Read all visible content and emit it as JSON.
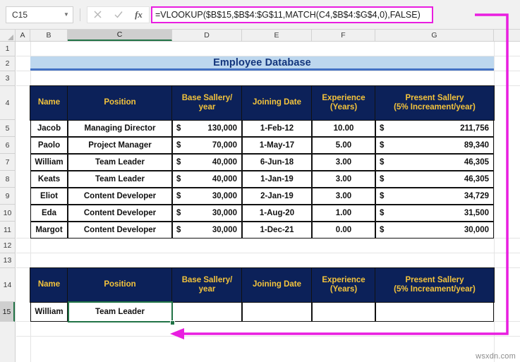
{
  "formula_bar": {
    "name_box_value": "C15",
    "name_box_dropdown_icon": "chevron-down-icon",
    "cancel_icon": "close-icon",
    "confirm_icon": "check-icon",
    "function_icon": "fx-icon",
    "formula": "=VLOOKUP($B$15,$B$4:$G$11,MATCH(C4,$B$4:$G$4,0),FALSE)",
    "highlight_color": "#e91ee0"
  },
  "grid": {
    "column_headers": [
      "A",
      "B",
      "C",
      "D",
      "E",
      "F",
      "G"
    ],
    "selected_column": "C",
    "row_headers": [
      "1",
      "2",
      "3",
      "4",
      "5",
      "6",
      "7",
      "8",
      "9",
      "10",
      "11",
      "12",
      "13",
      "14",
      "15"
    ],
    "selected_row": "15"
  },
  "sheet": {
    "title": "Employee Database",
    "title_bg": "#bdd7ee",
    "title_text_color": "#13357c",
    "header_bg": "#0c2159",
    "header_text_color": "#f3c33c",
    "selection_color": "#217346",
    "columns": [
      "Name",
      "Position",
      "Base Sallery/ year",
      "Joining Date",
      "Experience (Years)",
      "Present Sallery (5% Increament/year)"
    ],
    "column_lines": {
      "base_sallery_line1": "Base Sallery/",
      "base_sallery_line2": "year",
      "joining_date_line1": "Joining Date",
      "experience_line1": "Experience",
      "experience_line2": "(Years)",
      "present_sallery_line1": "Present Sallery",
      "present_sallery_line2": "(5% Increament/year)"
    },
    "rows": [
      {
        "name": "Jacob",
        "position": "Managing Director",
        "base_currency": "$",
        "base_amount": "130,000",
        "joining_date": "1-Feb-12",
        "experience": "10.00",
        "present_currency": "$",
        "present_amount": "211,756"
      },
      {
        "name": "Paolo",
        "position": "Project Manager",
        "base_currency": "$",
        "base_amount": "70,000",
        "joining_date": "1-May-17",
        "experience": "5.00",
        "present_currency": "$",
        "present_amount": "89,340"
      },
      {
        "name": "William",
        "position": "Team Leader",
        "base_currency": "$",
        "base_amount": "40,000",
        "joining_date": "6-Jun-18",
        "experience": "3.00",
        "present_currency": "$",
        "present_amount": "46,305"
      },
      {
        "name": "Keats",
        "position": "Team Leader",
        "base_currency": "$",
        "base_amount": "40,000",
        "joining_date": "1-Jan-19",
        "experience": "3.00",
        "present_currency": "$",
        "present_amount": "46,305"
      },
      {
        "name": "Eliot",
        "position": "Content Developer",
        "base_currency": "$",
        "base_amount": "30,000",
        "joining_date": "2-Jan-19",
        "experience": "3.00",
        "present_currency": "$",
        "present_amount": "34,729"
      },
      {
        "name": "Eda",
        "position": "Content Developer",
        "base_currency": "$",
        "base_amount": "30,000",
        "joining_date": "1-Aug-20",
        "experience": "1.00",
        "present_currency": "$",
        "present_amount": "31,500"
      },
      {
        "name": "Margot",
        "position": "Content Developer",
        "base_currency": "$",
        "base_amount": "30,000",
        "joining_date": "1-Dec-21",
        "experience": "0.00",
        "present_currency": "$",
        "present_amount": "30,000"
      }
    ],
    "lookup_result": {
      "name": "William",
      "position": "Team Leader",
      "base_sallery": "",
      "joining_date": "",
      "experience": "",
      "present_sallery": ""
    }
  },
  "annotation": {
    "color": "#e91ee0",
    "shape": "callout-arrow-from-formula-bar-to-C15"
  },
  "watermark": "wsxdn.com"
}
